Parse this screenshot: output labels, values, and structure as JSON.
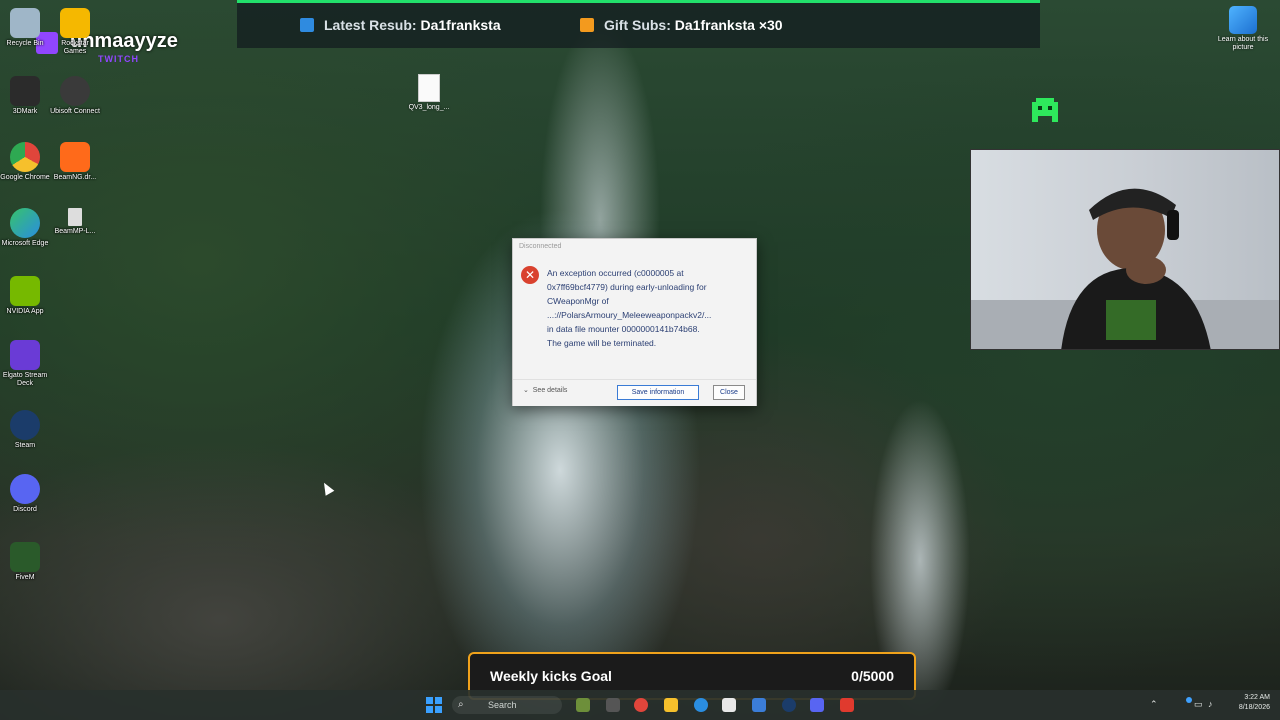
{
  "banner": {
    "resub_label": "Latest Resub:",
    "resub_name": "Da1franksta",
    "gift_label": "Gift Subs:",
    "gift_value": "Da1franksta ×30"
  },
  "twitch": {
    "username": "uhmaayyze",
    "sub": "TWITCH"
  },
  "desktop_icons": [
    {
      "label": "Recycle Bin",
      "color": "#9fb6c8"
    },
    {
      "label": "Rockstar Games",
      "color": "#f5b800"
    },
    {
      "label": "3DMark",
      "color": "#2b2b2b"
    },
    {
      "label": "Ubisoft Connect",
      "color": "#3a3a3a"
    },
    {
      "label": "Google Chrome",
      "color": "#e0453b"
    },
    {
      "label": "BeamNG.dr...",
      "color": "#ff6a1a"
    },
    {
      "label": "Microsoft Edge",
      "color": "#2a8de0"
    },
    {
      "label": "BeamMP-L...",
      "color": "#dddddd"
    },
    {
      "label": "NVIDIA App",
      "color": "#76b900"
    },
    {
      "label": "Elgato Stream Deck",
      "color": "#6a3bd6"
    },
    {
      "label": "Steam",
      "color": "#1b3c6a"
    },
    {
      "label": "Discord",
      "color": "#5865f2"
    },
    {
      "label": "FiveM",
      "color": "#2a5a2a"
    }
  ],
  "file_icon": {
    "label": "QV3_long_..."
  },
  "learn": {
    "label": "Learn about this picture"
  },
  "dialog": {
    "title": "Disconnected",
    "message_lines": [
      "An exception occurred (c0000005 at",
      "0x7ff69bcf4779) during early-unloading for",
      "CWeaponMgr of",
      "...://PolarsArmoury_Meleeweaponpackv2/...",
      "in data file mounter 0000000141b74b68.",
      "The game will be terminated."
    ],
    "see_details": "See details",
    "save_button": "Save information",
    "close_button": "Close"
  },
  "goal": {
    "label": "Weekly kicks Goal",
    "count": "0/5000"
  },
  "taskbar": {
    "search_placeholder": "Search",
    "time": "3:22 AM",
    "date": "8/18/2026"
  }
}
